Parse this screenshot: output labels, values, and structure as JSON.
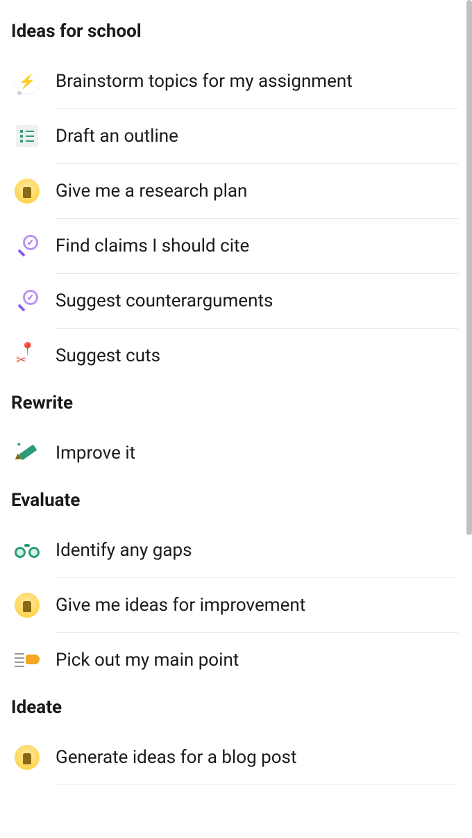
{
  "sections": [
    {
      "title": "Ideas for school",
      "items": [
        {
          "icon": "lightning",
          "label": "Brainstorm topics for my assignment"
        },
        {
          "icon": "outline",
          "label": "Draft an outline"
        },
        {
          "icon": "bulb",
          "label": "Give me a research plan"
        },
        {
          "icon": "magnify",
          "label": "Find claims I should cite"
        },
        {
          "icon": "magnify",
          "label": "Suggest counterarguments"
        },
        {
          "icon": "pin",
          "label": "Suggest cuts"
        }
      ]
    },
    {
      "title": "Rewrite",
      "items": [
        {
          "icon": "pen",
          "label": "Improve it"
        }
      ]
    },
    {
      "title": "Evaluate",
      "items": [
        {
          "icon": "binoc",
          "label": "Identify any gaps"
        },
        {
          "icon": "bulb",
          "label": "Give me ideas for improvement"
        },
        {
          "icon": "point",
          "label": "Pick out my main point"
        }
      ]
    },
    {
      "title": "Ideate",
      "items": [
        {
          "icon": "bulb",
          "label": "Generate ideas for a blog post"
        }
      ]
    }
  ]
}
